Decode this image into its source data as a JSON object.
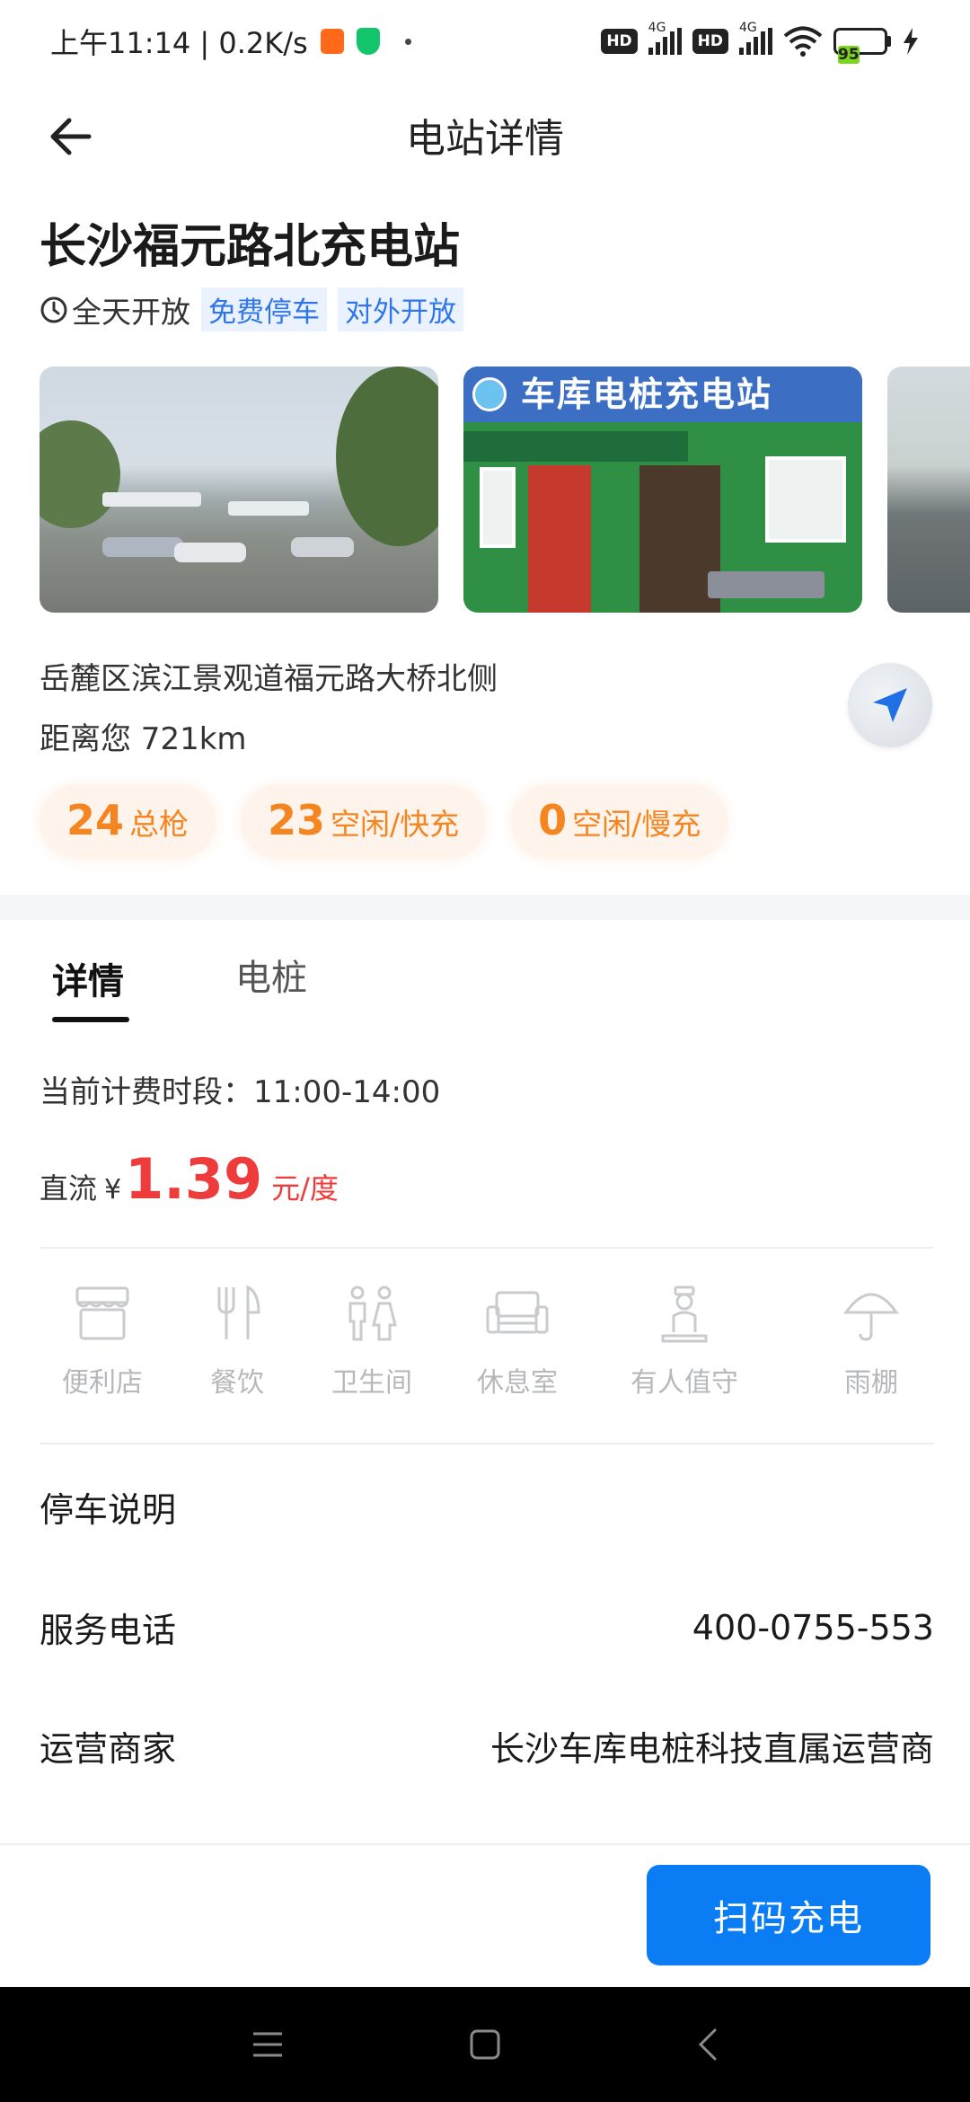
{
  "status_bar": {
    "time_speed": "上午11:14 | 0.2K/s",
    "hd1": "HD",
    "net1": "4G",
    "hd2": "HD",
    "net2": "4G",
    "battery": "95"
  },
  "header": {
    "title": "电站详情"
  },
  "station": {
    "name": "长沙福元路北充电站",
    "hours": "全天开放",
    "tags": [
      "免费停车",
      "对外开放"
    ],
    "photo2_sign": "车库电桩充电站",
    "address": "岳麓区滨江景观道福元路大桥北侧",
    "distance": "距离您 721km"
  },
  "stats": [
    {
      "value": "24",
      "label": "总枪"
    },
    {
      "value": "23",
      "label": "空闲/快充"
    },
    {
      "value": "0",
      "label": "空闲/慢充"
    }
  ],
  "tabs": {
    "detail": "详情",
    "pile": "电桩"
  },
  "pricing": {
    "period": "当前计费时段：11:00-14:00",
    "type": "直流",
    "currency": "¥",
    "price": "1.39",
    "unit": "元/度"
  },
  "facilities": [
    {
      "label": "便利店",
      "icon": "store-icon"
    },
    {
      "label": "餐饮",
      "icon": "fork-knife-icon"
    },
    {
      "label": "卫生间",
      "icon": "restroom-icon"
    },
    {
      "label": "休息室",
      "icon": "sofa-icon"
    },
    {
      "label": "有人值守",
      "icon": "attendant-icon"
    },
    {
      "label": "雨棚",
      "icon": "umbrella-icon"
    }
  ],
  "info": {
    "parking_key": "停车说明",
    "phone_key": "服务电话",
    "phone_val": "400-0755-553",
    "operator_key": "运营商家",
    "operator_val": "长沙车库电桩科技直属运营商"
  },
  "actions": {
    "scan": "扫码充电"
  },
  "colors": {
    "accent_blue": "#0a7df5",
    "tag_blue": "#2f76e8",
    "stat_orange": "#f58521",
    "price_red": "#ee3b3b"
  }
}
